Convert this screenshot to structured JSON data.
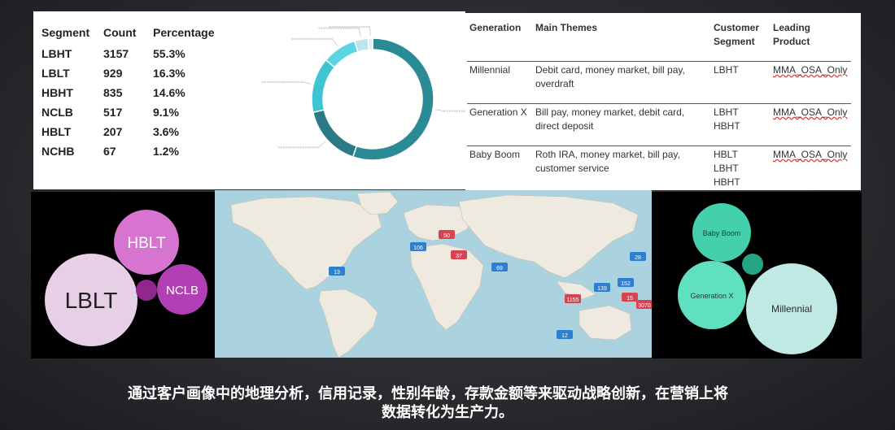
{
  "segments": {
    "headers": [
      "Segment",
      "Count",
      "Percentage"
    ],
    "rows": [
      {
        "segment": "LBHT",
        "count": "3157",
        "pct": "55.3%"
      },
      {
        "segment": "LBLT",
        "count": "929",
        "pct": "16.3%"
      },
      {
        "segment": "HBHT",
        "count": "835",
        "pct": "14.6%"
      },
      {
        "segment": "NCLB",
        "count": "517",
        "pct": "9.1%"
      },
      {
        "segment": "HBLT",
        "count": "207",
        "pct": "3.6%"
      },
      {
        "segment": "NCHB",
        "count": "67",
        "pct": "1.2%"
      }
    ]
  },
  "chart_data": {
    "type": "pie",
    "categories": [
      "LBHT",
      "LBLT",
      "HBHT",
      "NCLB",
      "HBLT",
      "NCHB"
    ],
    "values": [
      55.3,
      16.3,
      14.6,
      9.1,
      3.6,
      1.2
    ],
    "colors": [
      "#2a8a96",
      "#2b7a86",
      "#3ec4d2",
      "#5ad6e2",
      "#b9e6ec",
      "#d9f2f5"
    ],
    "title": ""
  },
  "generations": {
    "headers": {
      "generation": "Generation",
      "themes": "Main Themes",
      "segment_1": "Customer",
      "segment_2": "Segment",
      "product_1": "Leading",
      "product_2": "Product"
    },
    "rows": [
      {
        "generation": "Millennial",
        "themes_1": "Debit card, money market, bill pay,",
        "themes_2": "overdraft",
        "segments": [
          "LBHT"
        ],
        "product": "MMA_OSA_Only"
      },
      {
        "generation": "Generation X",
        "themes_1": "Bill pay, money market, debit card,",
        "themes_2": "direct deposit",
        "segments": [
          "LBHT",
          "HBHT"
        ],
        "product": "MMA_OSA_Only"
      },
      {
        "generation": "Baby Boom",
        "themes_1": "Roth IRA, money market, bill pay,",
        "themes_2": "customer service",
        "segments": [
          "HBLT",
          "LBHT",
          "HBHT"
        ],
        "product": "MMA_OSA_Only"
      }
    ]
  },
  "left_bubbles": [
    {
      "label": "LBLT",
      "color": "#e7cfe6",
      "text_color": "#222222"
    },
    {
      "label": "HBLT",
      "color": "#d774cf",
      "text_color": "#ffffff"
    },
    {
      "label": "NCLB",
      "color": "#b33fb4",
      "text_color": "#ffffff"
    },
    {
      "label": "",
      "color": "#8f278f",
      "text_color": "#ffffff"
    }
  ],
  "right_bubbles": [
    {
      "label": "Baby Boom",
      "color": "#44d0ad",
      "text_color": "#1d3a34"
    },
    {
      "label": "Generation X",
      "color": "#5fe0c0",
      "text_color": "#1d3a34"
    },
    {
      "label": "Millennial",
      "color": "#bfe9e2",
      "text_color": "#2b2b2b"
    },
    {
      "label": "",
      "color": "#26a586",
      "text_color": "#1d3a34"
    }
  ],
  "map": {
    "markers": [
      "1155",
      "3070",
      "139",
      "152",
      "28",
      "15",
      "12",
      "50",
      "13",
      "37",
      "69",
      "106"
    ]
  },
  "caption": {
    "line1": "通过客户画像中的地理分析，信用记录，性别年龄，存款金额等来驱动战略创新，在营销上将",
    "line2": "数据转化为生产力。"
  }
}
